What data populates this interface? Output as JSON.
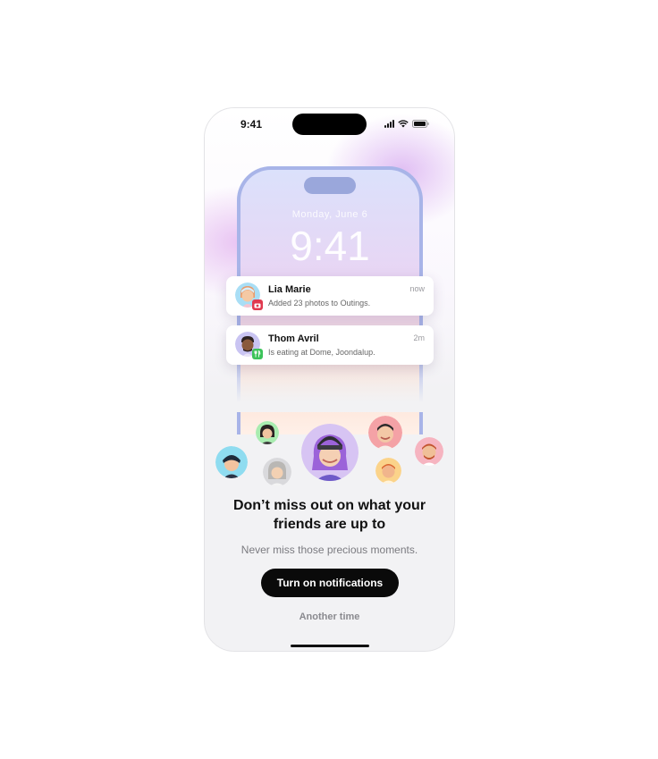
{
  "status_bar": {
    "time": "9:41"
  },
  "lock_screen": {
    "date": "Monday, June 6",
    "time": "9:41"
  },
  "notifications": [
    {
      "name": "Lia Marie",
      "message": "Added 23 photos to Outings.",
      "time": "now",
      "app_icon": "camera-icon",
      "badge_color": "#e0394f",
      "avatar_color": "#a9def5"
    },
    {
      "name": "Thom Avril",
      "message": "Is eating at Dome, Joondalup.",
      "time": "2m",
      "app_icon": "fork-knife-icon",
      "badge_color": "#3cc35a",
      "avatar_color": "#c9c4f2"
    }
  ],
  "headline": {
    "line1": "Don’t miss out on what your",
    "line2": "friends are up to"
  },
  "subtext": "Never miss those precious moments.",
  "primary_button": "Turn on notifications",
  "secondary_button": "Another time",
  "colors": {
    "primary": "#0a0a0a",
    "background": "#f2f2f4",
    "muted_text": "#7b7b80"
  }
}
